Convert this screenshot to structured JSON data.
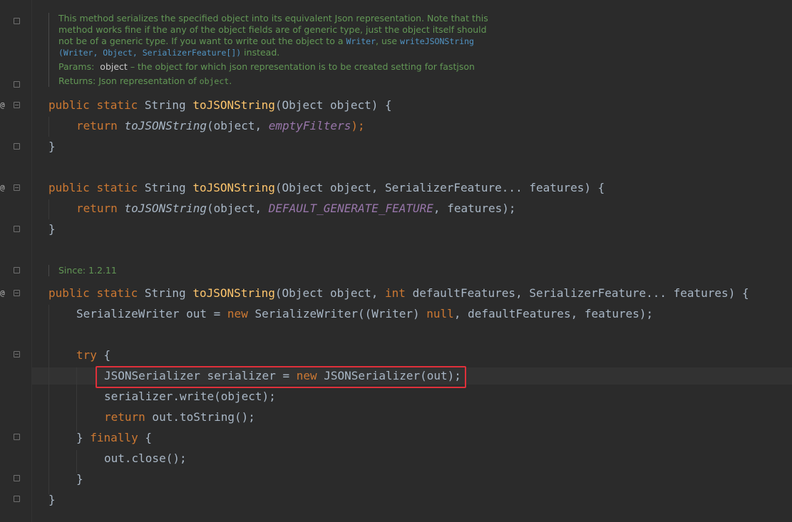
{
  "doc1": {
    "lines": [
      "This method serializes the specified object into its equivalent Json representation. Note that this",
      "method works fine if the any of the object fields are of generic type, just the object itself should",
      "not be of a generic type. If you want to write out the object to a"
    ],
    "writer_ref": "Writer",
    "use_text": ", use",
    "method_ref": "writeJSONString",
    "method_args": "(Writer, Object, SerializerFeature[])",
    "instead_text": "instead.",
    "params_label": "Params:",
    "param_name": "object",
    "param_desc": "– the object for which json representation is to be created setting for fastjson",
    "returns_label": "Returns:",
    "returns_desc": "Json representation of",
    "returns_obj": "object",
    "returns_end": "."
  },
  "doc2": {
    "since": "Since: 1.2.11"
  },
  "gutter": {
    "override_mark": "@"
  },
  "code": {
    "kw_public": "public",
    "kw_static": "static",
    "kw_return": "return",
    "kw_new": "new",
    "kw_int": "int",
    "kw_try": "try",
    "kw_finally": "finally",
    "kw_null": "null",
    "type_string": "String",
    "type_object": "Object",
    "method_name": "toJSONString",
    "empty_filters": "emptyFilters",
    "default_feature": "DEFAULT_GENERATE_FEATURE",
    "serializer_feature": "SerializerFeature",
    "serialize_writer": "SerializeWriter",
    "json_serializer": "JSONSerializer",
    "writer_type": "Writer",
    "m1_sig_tail": "(Object object) {",
    "m1_body_a": "(object, ",
    "m1_body_end": ");",
    "close_brace": "}",
    "m2_sig_tail_a": "(Object object, SerializerFeature",
    "m2_sig_tail_b": "... features) {",
    "m2_body_a": "(object, ",
    "m2_body_b": ", features);",
    "m3_sig_a": "(Object object, ",
    "m3_sig_b": " defaultFeatures, SerializerFeature",
    "m3_sig_c": "... features) {",
    "m3_l1_a": "SerializeWriter out = ",
    "m3_l1_b": " SerializeWriter((Writer) ",
    "m3_l1_c": ", defaultFeatures, features);",
    "try_open": " {",
    "m3_l2_a": "JSONSerializer serializer = ",
    "m3_l2_b": " JSONSerializer(out);",
    "m3_l3": "serializer.write(object);",
    "m3_l4_b": " out.toString();",
    "finally_open_a": "} ",
    "finally_open_b": " {",
    "m3_l5": "out.close();"
  }
}
